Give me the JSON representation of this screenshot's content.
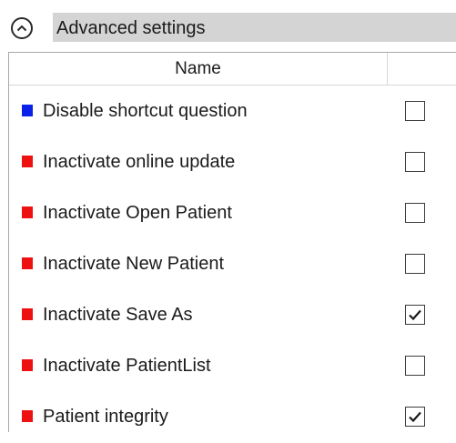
{
  "section": {
    "title": "Advanced settings",
    "expanded": true,
    "toggle_icon": "chevron-up-icon"
  },
  "table": {
    "column_header": "Name",
    "rows": [
      {
        "label": "Disable shortcut question",
        "color": "#0a22e8",
        "checked": false
      },
      {
        "label": "Inactivate online update",
        "color": "#ee1111",
        "checked": false
      },
      {
        "label": "Inactivate Open Patient",
        "color": "#ee1111",
        "checked": false
      },
      {
        "label": "Inactivate New Patient",
        "color": "#ee1111",
        "checked": false
      },
      {
        "label": "Inactivate Save As",
        "color": "#ee1111",
        "checked": true
      },
      {
        "label": "Inactivate PatientList",
        "color": "#ee1111",
        "checked": false
      },
      {
        "label": "Patient integrity",
        "color": "#ee1111",
        "checked": true
      }
    ]
  }
}
